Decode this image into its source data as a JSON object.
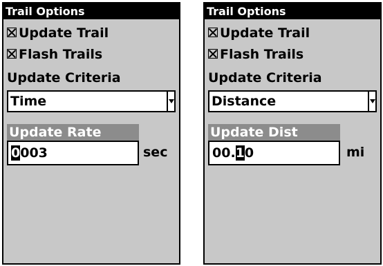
{
  "panels": [
    {
      "title": "Trail Options",
      "update_trail": "Update Trail",
      "flash_trails": "Flash Trails",
      "criteria_label": "Update Criteria",
      "criteria_value": "Time",
      "field_label": "Update Rate",
      "field_value_before": "",
      "field_value_cursor": "0",
      "field_value_after": "003",
      "unit": "sec"
    },
    {
      "title": "Trail Options",
      "update_trail": "Update Trail",
      "flash_trails": "Flash Trails",
      "criteria_label": "Update Criteria",
      "criteria_value": "Distance",
      "field_label": "Update Dist",
      "field_value_before": "00.",
      "field_value_cursor": "1",
      "field_value_after": "0",
      "unit": "mi"
    }
  ]
}
